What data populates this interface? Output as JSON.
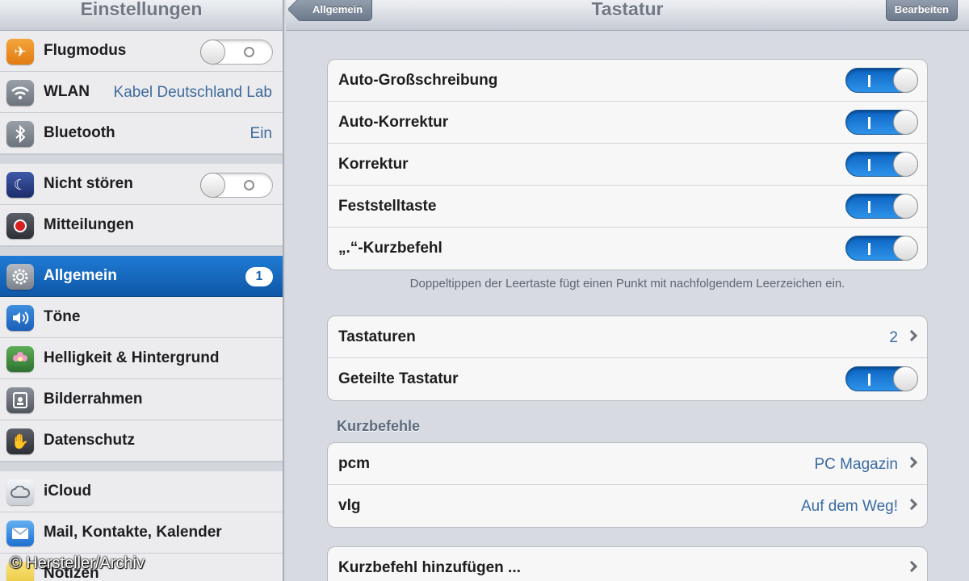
{
  "sidebar": {
    "title": "Einstellungen",
    "items": [
      {
        "label": "Flugmodus",
        "icon": "airplane-icon",
        "control": "switch-off"
      },
      {
        "label": "WLAN",
        "value": "Kabel Deutschland Lab",
        "icon": "wifi-icon"
      },
      {
        "label": "Bluetooth",
        "value": "Ein",
        "icon": "bluetooth-icon"
      },
      {
        "label": "Nicht stören",
        "icon": "moon-icon",
        "control": "switch-off"
      },
      {
        "label": "Mitteilungen",
        "icon": "notifications-icon"
      },
      {
        "label": "Allgemein",
        "badge": "1",
        "icon": "gear-icon",
        "selected": true
      },
      {
        "label": "Töne",
        "icon": "speaker-icon"
      },
      {
        "label": "Helligkeit & Hintergrund",
        "icon": "flower-icon"
      },
      {
        "label": "Bilderrahmen",
        "icon": "picture-frame-icon"
      },
      {
        "label": "Datenschutz",
        "icon": "hand-icon"
      },
      {
        "label": "iCloud",
        "icon": "cloud-icon"
      },
      {
        "label": "Mail, Kontakte, Kalender",
        "icon": "mail-icon"
      },
      {
        "label": "Notizen",
        "icon": "notes-icon"
      }
    ]
  },
  "navbar": {
    "title": "Tastatur",
    "back_label": "Allgemein",
    "edit_label": "Bearbeiten"
  },
  "toggles_group": [
    {
      "label": "Auto-Großschreibung",
      "on": true
    },
    {
      "label": "Auto-Korrektur",
      "on": true
    },
    {
      "label": "Korrektur",
      "on": true
    },
    {
      "label": "Feststelltaste",
      "on": true
    },
    {
      "label": "„.“-Kurzbefehl",
      "on": true
    }
  ],
  "footnote": "Doppeltippen der Leertaste fügt einen Punkt mit nachfolgendem Leerzeichen ein.",
  "keyboards_group": [
    {
      "label": "Tastaturen",
      "value": "2"
    },
    {
      "label": "Geteilte Tastatur",
      "on": true
    }
  ],
  "shortcuts_header": "Kurzbefehle",
  "shortcuts": [
    {
      "label": "pcm",
      "value": "PC Magazin"
    },
    {
      "label": "vlg",
      "value": "Auf dem Weg!"
    }
  ],
  "add_shortcut_label": "Kurzbefehl hinzufügen ...",
  "watermark": "© Hersteller/Archiv",
  "colors": {
    "accent_blue": "#1a6fcf",
    "selection_blue": "#1668c0",
    "value_blue": "#3a6ba3"
  }
}
